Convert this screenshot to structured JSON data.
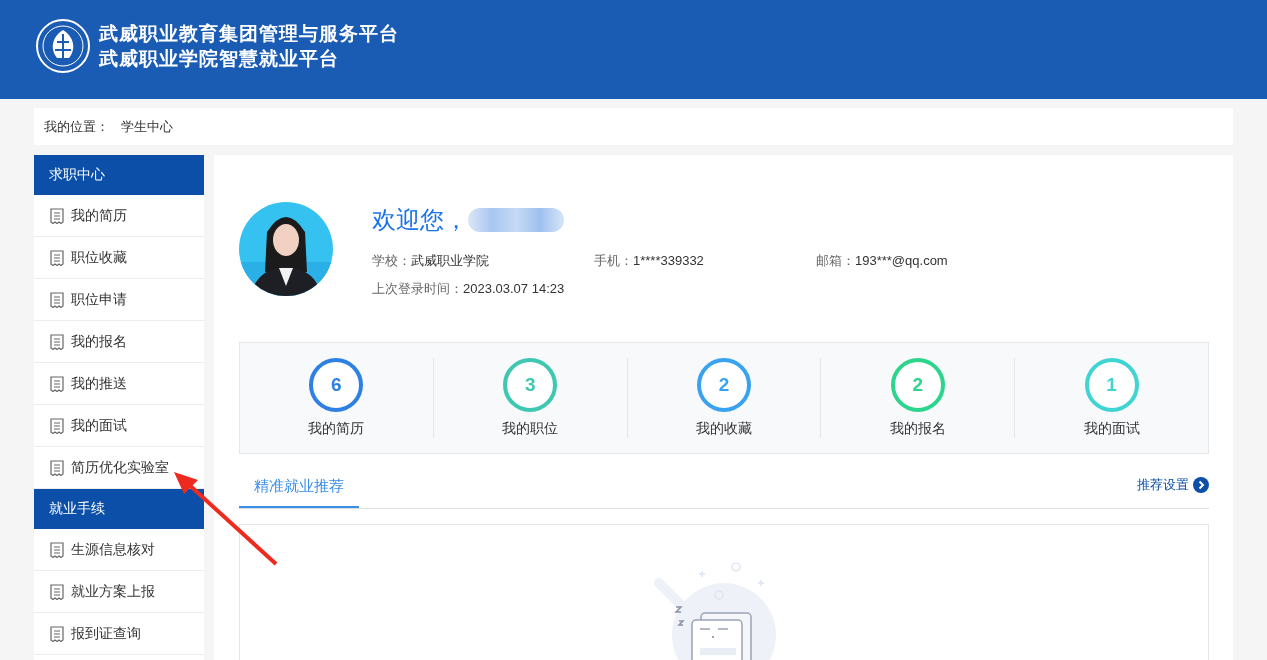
{
  "header": {
    "title_lines": [
      "武威职业教育集团管理与服务平台",
      "武威职业学院智慧就业平台"
    ]
  },
  "breadcrumb": {
    "label": "我的位置：",
    "value": "学生中心"
  },
  "sidebar": {
    "groups": [
      {
        "title": "求职中心",
        "items": [
          {
            "label": "我的简历"
          },
          {
            "label": "职位收藏"
          },
          {
            "label": "职位申请"
          },
          {
            "label": "我的报名"
          },
          {
            "label": "我的推送"
          },
          {
            "label": "我的面试"
          },
          {
            "label": "简历优化实验室"
          }
        ]
      },
      {
        "title": "就业手续",
        "items": [
          {
            "label": "生源信息核对"
          },
          {
            "label": "就业方案上报"
          },
          {
            "label": "报到证查询"
          }
        ]
      }
    ]
  },
  "profile": {
    "greeting": "欢迎您，",
    "fields": [
      {
        "label": "学校：",
        "value": "武威职业学院"
      },
      {
        "label": "手机：",
        "value": "1****339332"
      },
      {
        "label": "邮箱：",
        "value": "193***@qq.com"
      },
      {
        "label": "上次登录时间：",
        "value": "2023.03.07 14:23"
      }
    ]
  },
  "stats": [
    {
      "value": "6",
      "label": "我的简历",
      "color": "#2f80e3"
    },
    {
      "value": "3",
      "label": "我的职位",
      "color": "#3ec7b1"
    },
    {
      "value": "2",
      "label": "我的收藏",
      "color": "#3aa3ef"
    },
    {
      "value": "2",
      "label": "我的报名",
      "color": "#2dd58c"
    },
    {
      "value": "1",
      "label": "我的面试",
      "color": "#41d4d4"
    }
  ],
  "tabs": [
    {
      "label": "精准就业推荐",
      "selected": true
    }
  ],
  "settings_link": "推荐设置"
}
